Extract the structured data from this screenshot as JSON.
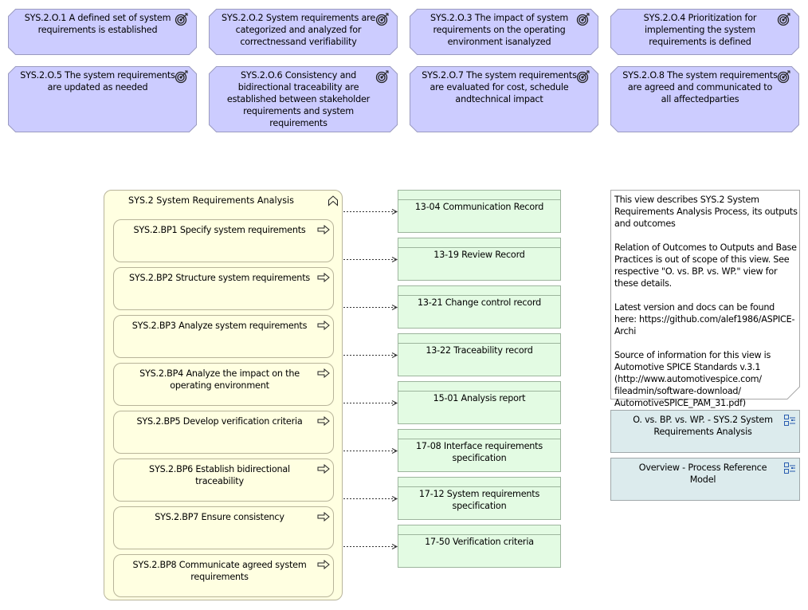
{
  "outcomes": [
    {
      "id": "SYS.2.O.1",
      "text": "SYS.2.O.1 A defined set of system requirements is established"
    },
    {
      "id": "SYS.2.O.2",
      "text": "SYS.2.O.2 System requirements are categorized and analyzed for correctnessand verifiability"
    },
    {
      "id": "SYS.2.O.3",
      "text": "SYS.2.O.3 The impact of system requirements on the operating environment isanalyzed"
    },
    {
      "id": "SYS.2.O.4",
      "text": "SYS.2.O.4 Prioritization for implementing the system requirements is defined"
    },
    {
      "id": "SYS.2.O.5",
      "text": "SYS.2.O.5 The system requirements are updated as needed"
    },
    {
      "id": "SYS.2.O.6",
      "text": "SYS.2.O.6 Consistency and bidirectional traceability are established between stakeholder requirements and system requirements"
    },
    {
      "id": "SYS.2.O.7",
      "text": "SYS.2.O.7 The system requirements are evaluated for cost, schedule andtechnical impact"
    },
    {
      "id": "SYS.2.O.8",
      "text": "SYS.2.O.8 The system requirements are agreed and communicated to all affectedparties"
    }
  ],
  "process": {
    "title": "SYS.2 System Requirements Analysis",
    "base_practices": [
      "SYS.2.BP1 Specify system requirements",
      "SYS.2.BP2 Structure system requirements",
      "SYS.2.BP3 Analyze system requirements",
      "SYS.2.BP4 Analyze the impact on the operating environment",
      "SYS.2.BP5 Develop verification criteria",
      "SYS.2.BP6 Establish bidirectional traceability",
      "SYS.2.BP7 Ensure consistency",
      "SYS.2.BP8 Communicate agreed system requirements"
    ]
  },
  "work_products": [
    "13-04 Communication Record",
    "13-19 Review Record",
    "13-21 Change control record",
    "13-22 Traceability record",
    "15-01 Analysis report",
    "17-08 Interface requirements specification",
    "17-12 System requirements specification",
    "17-50 Verification criteria"
  ],
  "note": {
    "text": "This view describes SYS.2 System Requirements Analysis Process, its outputs and outcomes\n\nRelation of Outcomes to Outputs and Base Practices is out of scope of this view. See respective \"O. vs. BP. vs. WP.\" view for these details.\n\nLatest version and docs can be found here: https://github.com/alef1986/ASPICE-Archi\n\nSource of information for this view is Automotive SPICE Standards v.3.1 (http://www.automotivespice.com/ fileadmin/software-download/ AutomotiveSPICE_PAM_31.pdf)"
  },
  "view_references": [
    "O. vs. BP. vs. WP. - SYS.2 System Requirements Analysis",
    "Overview - Process Reference Model"
  ],
  "colors": {
    "outcome_fill": "#ccccff",
    "process_fill": "#ffffe1",
    "work_product_fill": "#e3fbe3",
    "view_reference_fill": "#dcebed"
  }
}
